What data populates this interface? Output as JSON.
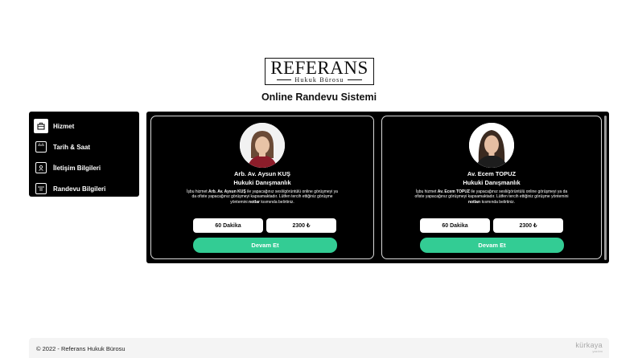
{
  "logo": {
    "main": "REFERANS",
    "sub": "Hukuk Bürosu"
  },
  "page_title": "Online Randevu Sistemi",
  "sidebar": {
    "items": [
      {
        "label": "Hizmet",
        "icon": "briefcase-icon",
        "active": true
      },
      {
        "label": "Tarih & Saat",
        "icon": "calendar-icon",
        "active": false
      },
      {
        "label": "İletişim Bilgileri",
        "icon": "contact-card-icon",
        "active": false
      },
      {
        "label": "Randevu Bilgileri",
        "icon": "calendar-list-icon",
        "active": false
      }
    ]
  },
  "cards": [
    {
      "name": "Arb. Av. Aysun KUŞ",
      "role": "Hukuki Danışmanlık",
      "desc_1": "İşbu hizmet ",
      "desc_name": "Arb. Av. Aysun KUŞ",
      "desc_2": " ile yapacağınız sesli/görüntülü online görüşmeyi ya da ofiste yapacağınız görüşmeyi kapsamaktadır. Lütfen tercih ettiğiniz görüşme yöntemini ",
      "desc_notes": "notlar",
      "desc_3": " kısmında belirtiniz.",
      "duration": "60 Dakika",
      "price": "2300 ₺",
      "button": "Devam Et"
    },
    {
      "name": "Av. Ecem TOPUZ",
      "role": "Hukuki Danışmanlık",
      "desc_1": "İşbu hizmet ",
      "desc_name": "Av. Ecem TOPUZ",
      "desc_2": " ile yapacağınız sesli/görüntülü online görüşmeyi ya da ofiste yapacağınız görüşmeyi kapsamaktadır. Lütfen tercih ettiğiniz görüşme yöntemini ",
      "desc_notes": "notları",
      "desc_3": " kısmında belirtiniz.",
      "duration": "60 Dakika",
      "price": "2300 ₺",
      "button": "Devam Et"
    }
  ],
  "footer": {
    "copyright": "© 2022 - Referans Hukuk Bürosu",
    "brand": "kürkaya",
    "brand_sub": "yazılım"
  },
  "colors": {
    "accent": "#33cc94",
    "panel": "#000000",
    "footer_bg": "#f4f4f4"
  }
}
